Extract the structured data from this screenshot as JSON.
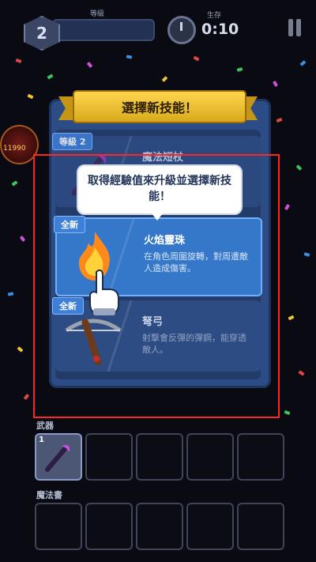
{
  "hud": {
    "level": "2",
    "xp_label": "等級",
    "timer_label": "生存",
    "timer_value": "0:10"
  },
  "emblem": {
    "text": "11990"
  },
  "modal": {
    "title": "選擇新技能！",
    "cards": [
      {
        "tag": "等級 2",
        "name": "魔法短杖",
        "desc": ""
      },
      {
        "tag": "全新",
        "name": "火焰靈珠",
        "desc": "在角色周圍旋轉，對周遭敵人造成傷害。"
      },
      {
        "tag": "全新",
        "name": "弩弓",
        "desc": "射擊會反彈的彈鋼，能穿透敵人。"
      }
    ]
  },
  "tooltip": {
    "text": "取得經驗值來升級並選擇新技能！"
  },
  "inventory": {
    "weapons_label": "武器",
    "weapon_level": "1",
    "spellbook_label": "魔法書"
  },
  "colors": {
    "highlight": "#ff2626",
    "selected_card": "#3577c9",
    "ribbon": "#ffd64d"
  }
}
